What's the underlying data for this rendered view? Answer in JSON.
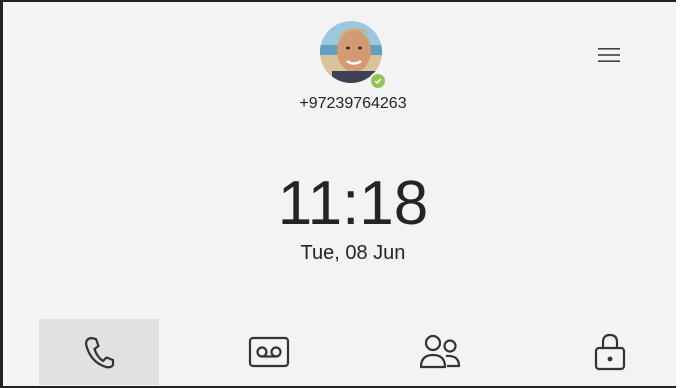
{
  "profile": {
    "phone_number": "+97239764263",
    "presence_status": "available",
    "presence_color": "#92c353"
  },
  "header": {
    "menu_icon": "hamburger-menu-icon"
  },
  "clock": {
    "time": "11:18",
    "date": "Tue, 08 Jun"
  },
  "nav": {
    "items": [
      {
        "icon": "phone-icon",
        "active": true
      },
      {
        "icon": "voicemail-icon",
        "active": false
      },
      {
        "icon": "people-icon",
        "active": false
      },
      {
        "icon": "lock-icon",
        "active": false
      }
    ]
  },
  "colors": {
    "background": "#f3f3f3",
    "active_tab": "#e1e1e1",
    "text": "#242424"
  }
}
